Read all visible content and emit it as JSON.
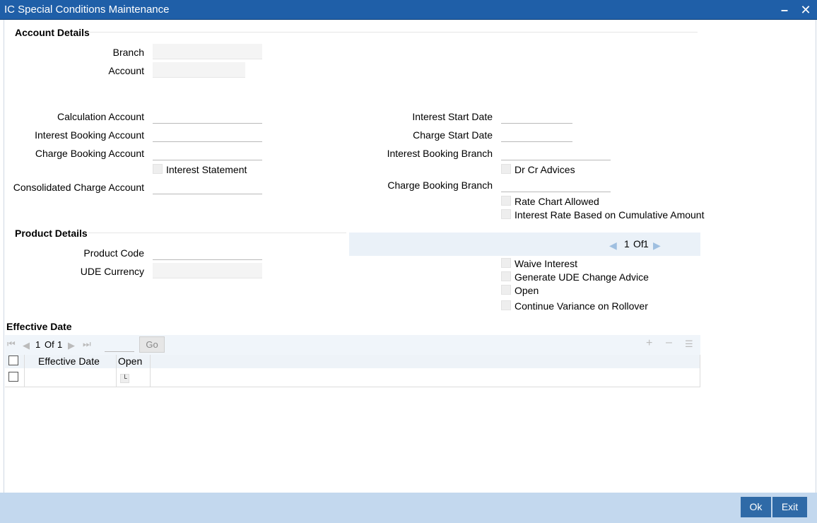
{
  "window": {
    "title": "IC Special Conditions Maintenance"
  },
  "account_details": {
    "heading": "Account Details",
    "branch_label": "Branch",
    "branch_value": "",
    "account_label": "Account",
    "account_value": "",
    "calculation_account_label": "Calculation Account",
    "interest_booking_account_label": "Interest Booking Account",
    "charge_booking_account_label": "Charge Booking Account",
    "interest_statement_label": "Interest Statement",
    "consolidated_charge_account_label": "Consolidated Charge Account",
    "interest_start_date_label": "Interest Start Date",
    "charge_start_date_label": "Charge Start Date",
    "interest_booking_branch_label": "Interest Booking Branch",
    "dr_cr_advices_label": "Dr Cr Advices",
    "charge_booking_branch_label": "Charge Booking Branch",
    "rate_chart_allowed_label": "Rate Chart Allowed",
    "interest_rate_cumulative_label": "Interest Rate Based on Cumulative Amount"
  },
  "product_details": {
    "heading": "Product Details",
    "product_code_label": "Product Code",
    "ude_currency_label": "UDE Currency",
    "pager": {
      "current": "1",
      "of": "Of",
      "total": "1"
    },
    "waive_interest_label": "Waive Interest",
    "generate_ude_label": "Generate UDE Change Advice",
    "open_label": "Open",
    "continue_variance_label": "Continue Variance on Rollover"
  },
  "effective_date": {
    "heading": "Effective Date",
    "pager": {
      "current": "1",
      "of": "Of",
      "total": "1"
    },
    "go_label": "Go",
    "columns": [
      "Effective Date",
      "Open"
    ]
  },
  "footer": {
    "ok_label": "Ok",
    "exit_label": "Exit"
  }
}
